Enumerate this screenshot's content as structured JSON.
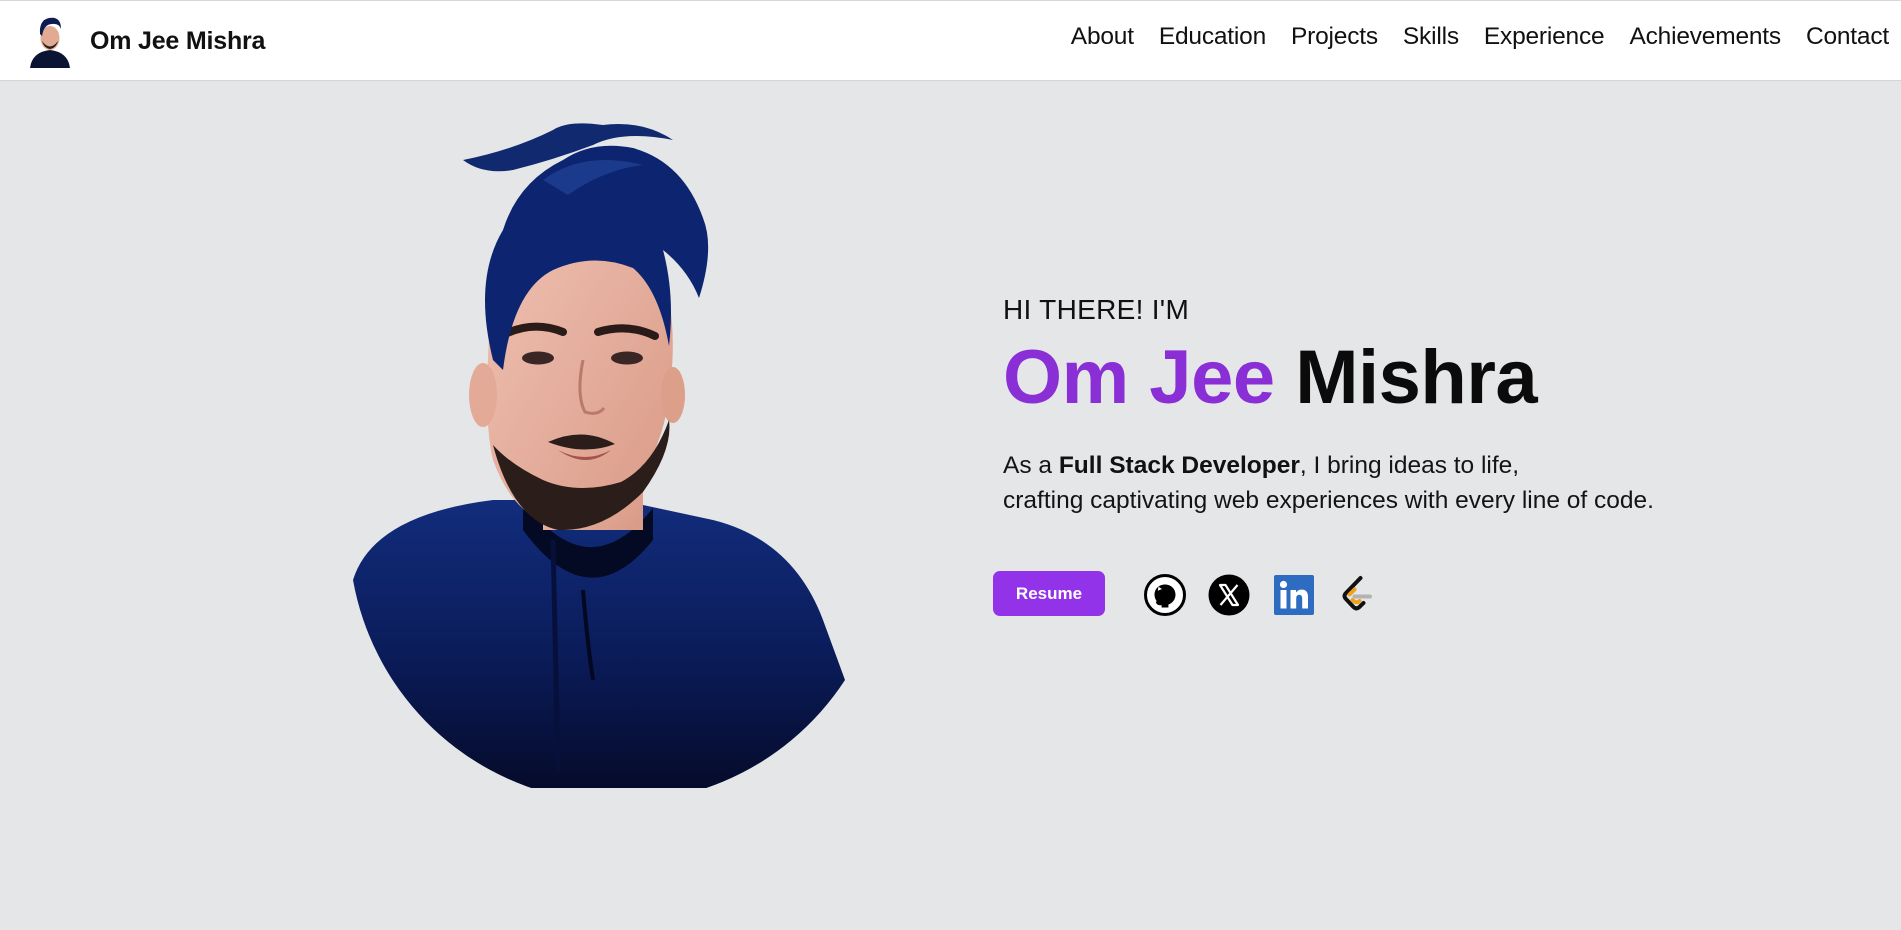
{
  "navbar": {
    "brand_name": "Om Jee Mishra",
    "avatar_icon": "profile-avatar",
    "links": [
      "About",
      "Education",
      "Projects",
      "Skills",
      "Experience",
      "Achievements",
      "Contact"
    ]
  },
  "hero": {
    "greeting": "HI THERE! I'M",
    "name_first": "Om Jee",
    "name_last": "Mishra",
    "tagline_prefix": "As a ",
    "tagline_role": "Full Stack Developer",
    "tagline_suffix": ", I bring ideas to life,",
    "tagline_line2": "crafting captivating web experiences with every line of code.",
    "resume_label": "Resume",
    "socials": [
      "github-icon",
      "x-icon",
      "linkedin-icon",
      "leetcode-icon"
    ]
  },
  "colors": {
    "accent": "#9233ea",
    "name_accent": "#8a2fd6",
    "background": "#e5e6e8",
    "navbar_bg": "#ffffff",
    "linkedin_blue": "#2d6cc0",
    "leetcode_orange": "#f0a21c"
  }
}
